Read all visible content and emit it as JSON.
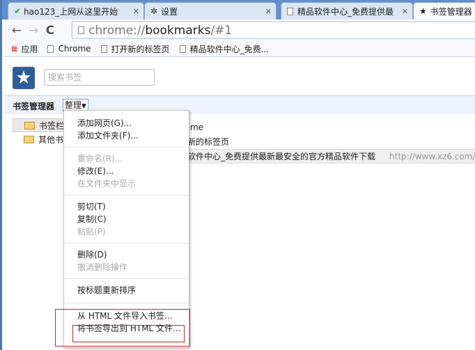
{
  "tabs": [
    {
      "label": "hao123_上网从这里开始",
      "icon": "hao123-icon"
    },
    {
      "label": "设置",
      "icon": "gear-icon"
    },
    {
      "label": "精品软件中心_免费提供最",
      "icon": "page-icon"
    },
    {
      "label": "书签管理器",
      "icon": "star-icon",
      "active": true
    }
  ],
  "address": {
    "scheme": "chrome://",
    "host": "bookmarks",
    "path": "/#1"
  },
  "bookmarks_bar": [
    {
      "label": "应用",
      "icon": "apps-icon"
    },
    {
      "label": "Chrome"
    },
    {
      "label": "打开新的标签页"
    },
    {
      "label": "精品软件中心_免费..."
    }
  ],
  "search": {
    "placeholder": "搜索书签"
  },
  "manager": {
    "title": "书签管理器",
    "organize": "整理"
  },
  "tree": [
    {
      "label": "书签栏",
      "selected": true
    },
    {
      "label": "其他书签"
    }
  ],
  "list": [
    {
      "title": "Chrome",
      "url": ""
    },
    {
      "title": "打开新的标签页",
      "url": ""
    },
    {
      "title": "精品软件中心_免费提供最新最安全的官方精品软件下载",
      "url": "http://www.xz6.com/"
    }
  ],
  "menu": {
    "add_page": "添加网页(G)...",
    "add_folder": "添加文件夹(F)...",
    "rename": "重命名(R)...",
    "edit": "修改(E)...",
    "show_in_folder": "在文件夹中显示",
    "cut": "剪切(T)",
    "copy": "复制(C)",
    "paste": "粘贴(P)",
    "delete": "删除(D)",
    "undo_delete": "撤消删除操作",
    "sort": "按标题重新排序",
    "import": "从 HTML 文件导入书签...",
    "export": "将书签导出到 HTML 文件..."
  },
  "colors": {
    "highlight": "#c0282d",
    "frame": "#4a78b8"
  }
}
